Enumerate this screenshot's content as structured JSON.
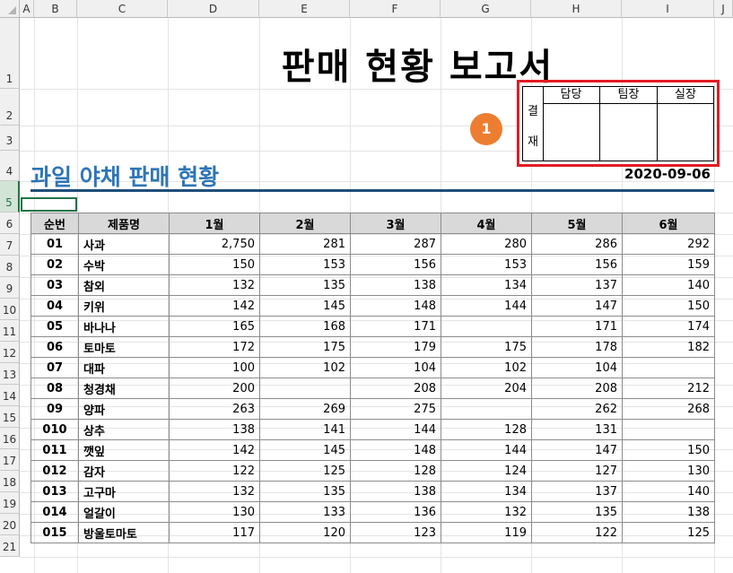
{
  "columns": [
    "A",
    "B",
    "C",
    "D",
    "E",
    "F",
    "G",
    "H",
    "I",
    "J"
  ],
  "rows": [
    "1",
    "2",
    "3",
    "4",
    "5",
    "6",
    "7",
    "8",
    "9",
    "10",
    "11",
    "12",
    "13",
    "14",
    "15",
    "16",
    "17",
    "18",
    "19",
    "20",
    "21"
  ],
  "title": "판매 현황 보고서",
  "approval": {
    "label_top": "결",
    "label_bottom": "재",
    "headers": [
      "담당",
      "팀장",
      "실장"
    ]
  },
  "badge": "1",
  "subtitle": "과일 야채 판매 현황",
  "report_date": "2020-09-06",
  "colors": {
    "accent": "#2e75b6",
    "highlight_border": "#e31b23",
    "badge": "#ed7d31",
    "header_fill": "#d9d9d9"
  },
  "table": {
    "headers": [
      "순번",
      "제품명",
      "1월",
      "2월",
      "3월",
      "4월",
      "5월",
      "6월"
    ],
    "rows": [
      [
        "01",
        "사과",
        "2,750",
        "281",
        "287",
        "280",
        "286",
        "292"
      ],
      [
        "02",
        "수박",
        "150",
        "153",
        "156",
        "153",
        "156",
        "159"
      ],
      [
        "03",
        "참외",
        "132",
        "135",
        "138",
        "134",
        "137",
        "140"
      ],
      [
        "04",
        "키위",
        "142",
        "145",
        "148",
        "144",
        "147",
        "150"
      ],
      [
        "05",
        "바나나",
        "165",
        "168",
        "171",
        "",
        "171",
        "174"
      ],
      [
        "06",
        "토마토",
        "172",
        "175",
        "179",
        "175",
        "178",
        "182"
      ],
      [
        "07",
        "대파",
        "100",
        "102",
        "104",
        "102",
        "104",
        ""
      ],
      [
        "08",
        "청경채",
        "200",
        "",
        "208",
        "204",
        "208",
        "212"
      ],
      [
        "09",
        "양파",
        "263",
        "269",
        "275",
        "",
        "262",
        "268"
      ],
      [
        "010",
        "상추",
        "138",
        "141",
        "144",
        "128",
        "131",
        ""
      ],
      [
        "011",
        "깻잎",
        "142",
        "145",
        "148",
        "144",
        "147",
        "150"
      ],
      [
        "012",
        "감자",
        "122",
        "125",
        "128",
        "124",
        "127",
        "130"
      ],
      [
        "013",
        "고구마",
        "132",
        "135",
        "138",
        "134",
        "137",
        "140"
      ],
      [
        "014",
        "얼갈이",
        "130",
        "133",
        "136",
        "132",
        "135",
        "138"
      ],
      [
        "015",
        "방울토마토",
        "117",
        "120",
        "123",
        "119",
        "122",
        "125"
      ]
    ]
  }
}
